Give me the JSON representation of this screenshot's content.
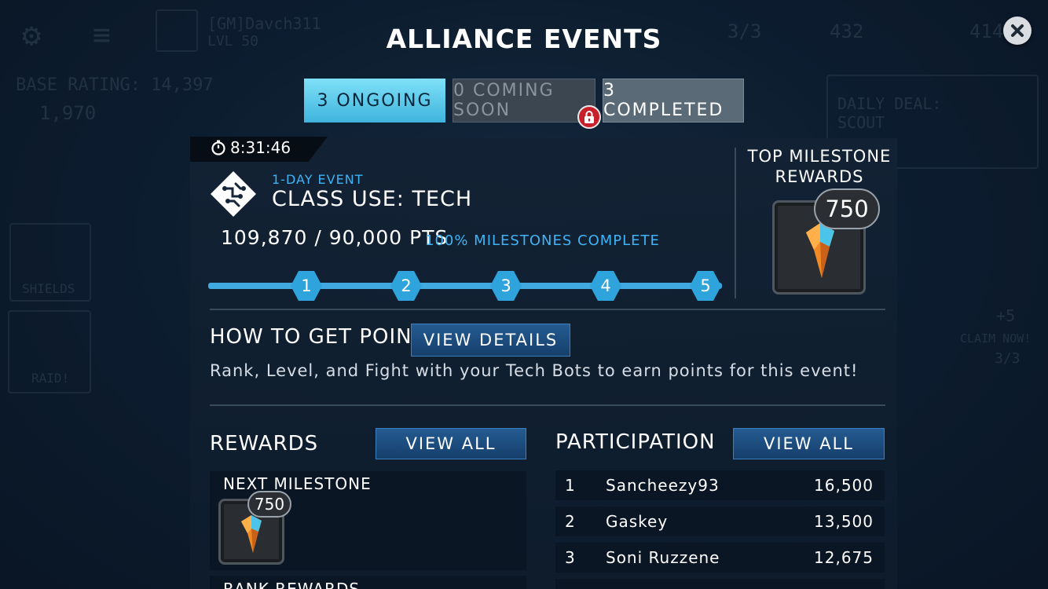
{
  "background": {
    "player_name": "[GM]Davch311",
    "player_level": "LVL 50",
    "base_rating_label": "BASE RATING: 14,397",
    "currency": "1,970",
    "energy": "3/3",
    "resource_a": "432",
    "resource_b": "414",
    "daily_deal": "DAILY DEAL:\nSCOUT",
    "shields_label": "SHIELDS",
    "raid_label": "RAID!",
    "claim_now": "CLAIM NOW!",
    "claim_count": "3/3",
    "claim_plus": "+5"
  },
  "modal": {
    "title": "ALLIANCE EVENTS",
    "tabs": [
      {
        "label": "3 ONGOING",
        "state": "active"
      },
      {
        "label": "0 COMING SOON",
        "state": "locked"
      },
      {
        "label": "3 COMPLETED",
        "state": "inactive"
      }
    ],
    "event": {
      "timer": "8:31:46",
      "kind": "1-DAY EVENT",
      "name": "CLASS USE: TECH",
      "points": "109,870 / 90,000 PTS",
      "milestones_complete": "100% MILESTONES COMPLETE",
      "milestones": [
        "1",
        "2",
        "3",
        "4",
        "5"
      ],
      "progress": 1.0
    },
    "top_milestone": {
      "title": "TOP MILESTONE\nREWARDS",
      "amount": "750"
    },
    "how_to": {
      "title": "HOW TO GET POINTS",
      "button": "VIEW DETAILS",
      "description": "Rank, Level, and Fight with your Tech Bots to earn points for this event!"
    },
    "rewards": {
      "title": "REWARDS",
      "button": "VIEW ALL",
      "next_milestone_label": "NEXT MILESTONE",
      "next_amount": "750",
      "rank_rewards_label": "RANK REWARDS"
    },
    "participation": {
      "title": "PARTICIPATION",
      "button": "VIEW ALL",
      "rows": [
        {
          "rank": "1",
          "name": "Sancheezy93",
          "score": "16,500"
        },
        {
          "rank": "2",
          "name": "Gaskey",
          "score": "13,500"
        },
        {
          "rank": "3",
          "name": "Soni Ruzzene",
          "score": "12,675"
        }
      ]
    }
  },
  "colors": {
    "accent": "#3fb3f5",
    "tab_active": "#5ccbeb",
    "lock": "#c8202a",
    "button": "#1d4f82"
  }
}
